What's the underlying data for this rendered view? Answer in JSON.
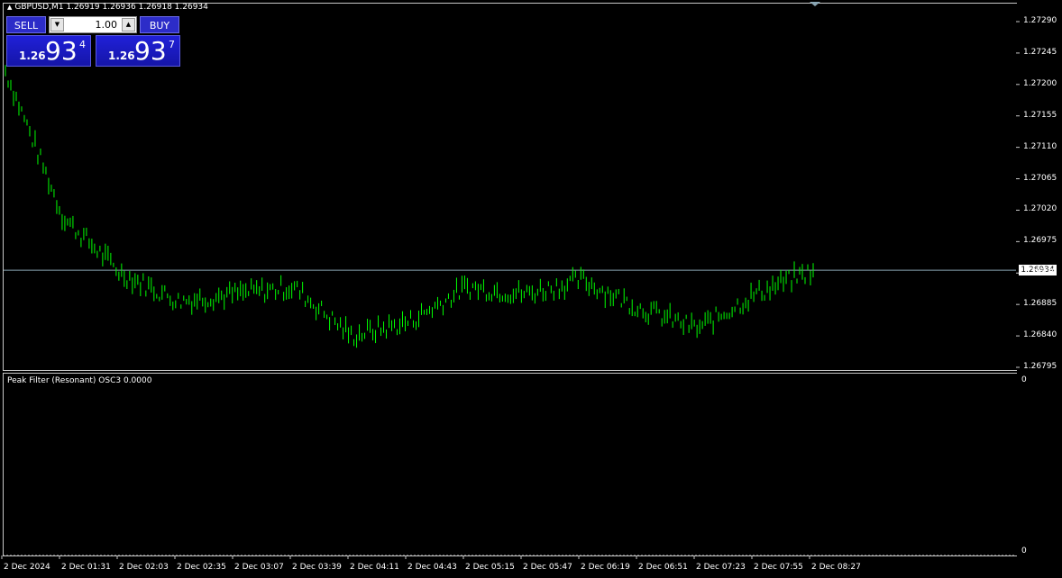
{
  "chart_header": {
    "symbol_timeframe": "GBPUSD,M1",
    "ohlc": "1.26919 1.26936 1.26918 1.26934"
  },
  "trade_panel": {
    "sell_label": "SELL",
    "buy_label": "BUY",
    "lot_value": "1.00",
    "sell_price": {
      "prefix": "1.26",
      "big": "93",
      "sup": "4"
    },
    "buy_price": {
      "prefix": "1.26",
      "big": "93",
      "sup": "7"
    }
  },
  "indicator": {
    "title": "Peak Filter (Resonant) OSC3 0.0000",
    "scale_top": "0",
    "scale_bottom": "0"
  },
  "price_scale": [
    "1.27290",
    "1.27245",
    "1.27200",
    "1.27155",
    "1.27110",
    "1.27065",
    "1.27020",
    "1.26975",
    "1.26930",
    "1.26885",
    "1.26840",
    "1.26795"
  ],
  "current_price_label": "1.26934",
  "time_labels": [
    "2 Dec 2024",
    "2 Dec 01:31",
    "2 Dec 02:03",
    "2 Dec 02:35",
    "2 Dec 03:07",
    "2 Dec 03:39",
    "2 Dec 04:11",
    "2 Dec 04:43",
    "2 Dec 05:15",
    "2 Dec 05:47",
    "2 Dec 06:19",
    "2 Dec 06:51",
    "2 Dec 07:23",
    "2 Dec 07:55",
    "2 Dec 08:27"
  ],
  "colors": {
    "background": "#000000",
    "bars": "#00ff00",
    "grid_border": "#c8c8c8",
    "button": "#2c2cc8"
  },
  "chart_data": {
    "type": "line",
    "x": [
      "2 Dec 2024",
      "2 Dec 01:31",
      "2 Dec 02:03",
      "2 Dec 02:35",
      "2 Dec 03:07",
      "2 Dec 03:39",
      "2 Dec 04:11",
      "2 Dec 04:43",
      "2 Dec 05:15",
      "2 Dec 05:47",
      "2 Dec 06:19",
      "2 Dec 06:51",
      "2 Dec 07:23",
      "2 Dec 07:55",
      "2 Dec 08:27"
    ],
    "series": [
      {
        "values": [
          1.2722,
          1.2701,
          1.2693,
          1.2689,
          1.269,
          1.2691,
          1.2684,
          1.2686,
          1.2691,
          1.269,
          1.2692,
          1.2688,
          1.2685,
          1.269,
          1.26934
        ]
      }
    ],
    "ylim": [
      1.26795,
      1.2729
    ],
    "current_price": 1.26934
  }
}
